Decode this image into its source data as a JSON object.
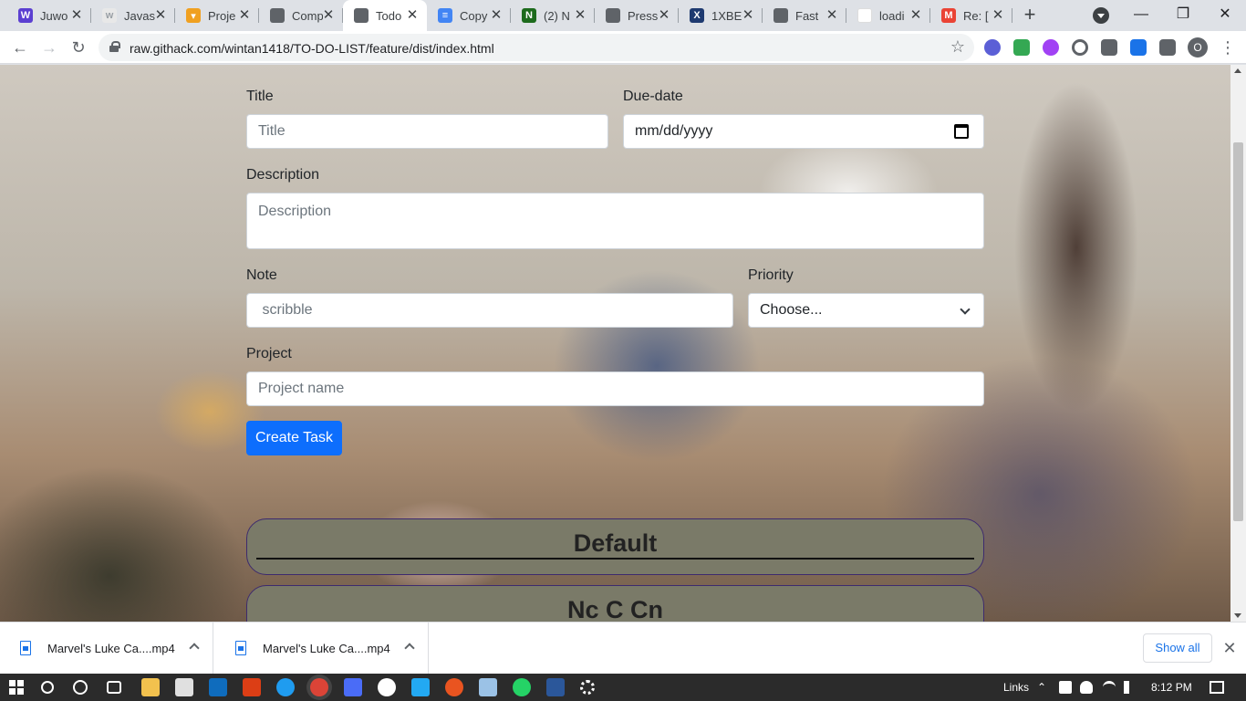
{
  "browser": {
    "tabs": [
      {
        "title": "Juwo",
        "favicon": "juwo-icon",
        "color": "#5b3fd1",
        "glyph": "W"
      },
      {
        "title": "Javas",
        "favicon": "w3-icon",
        "color": "#e8e8e8",
        "glyph": "w"
      },
      {
        "title": "Proje",
        "favicon": "folder-icon",
        "color": "#f0a020",
        "glyph": "▾"
      },
      {
        "title": "Comp",
        "favicon": "globe-icon",
        "color": "#5f6368",
        "glyph": ""
      },
      {
        "title": "Todo",
        "favicon": "globe-icon",
        "color": "#5f6368",
        "glyph": "",
        "active": true
      },
      {
        "title": "Copy",
        "favicon": "docs-icon",
        "color": "#4285f4",
        "glyph": "≡"
      },
      {
        "title": "(2) N",
        "favicon": "n-icon",
        "color": "#1d6b1d",
        "glyph": "N"
      },
      {
        "title": "Press",
        "favicon": "globe-icon",
        "color": "#5f6368",
        "glyph": ""
      },
      {
        "title": "1XBE",
        "favicon": "1x-icon",
        "color": "#1e3a70",
        "glyph": "X"
      },
      {
        "title": "Fast",
        "favicon": "globe-icon",
        "color": "#5f6368",
        "glyph": ""
      },
      {
        "title": "loadi",
        "favicon": "blank-icon",
        "color": "#ffffff",
        "glyph": ""
      },
      {
        "title": "Re: [",
        "favicon": "gmail-icon",
        "color": "#ea4335",
        "glyph": "M"
      }
    ],
    "new_tab": "+",
    "url": "raw.githack.com/wintan1418/TO-DO-LIST/feature/dist/index.html",
    "profile_initial": "O"
  },
  "form": {
    "title_label": "Title",
    "title_placeholder": "Title",
    "due_label": "Due-date",
    "due_placeholder": "mm/dd/yyyy",
    "description_label": "Description",
    "description_placeholder": "Description",
    "note_label": "Note",
    "note_placeholder": " scribble",
    "priority_label": "Priority",
    "priority_selected": "Choose...",
    "project_label": "Project",
    "project_placeholder": "Project name",
    "submit_label": "Create Task"
  },
  "projects": [
    {
      "name": "Default"
    },
    {
      "name": "Nc C Cn"
    }
  ],
  "downloads": {
    "items": [
      {
        "name": "Marvel's Luke Ca....mp4"
      },
      {
        "name": "Marvel's Luke Ca....mp4"
      }
    ],
    "show_all": "Show all"
  },
  "taskbar": {
    "links_label": "Links",
    "time": "8:12 PM"
  }
}
